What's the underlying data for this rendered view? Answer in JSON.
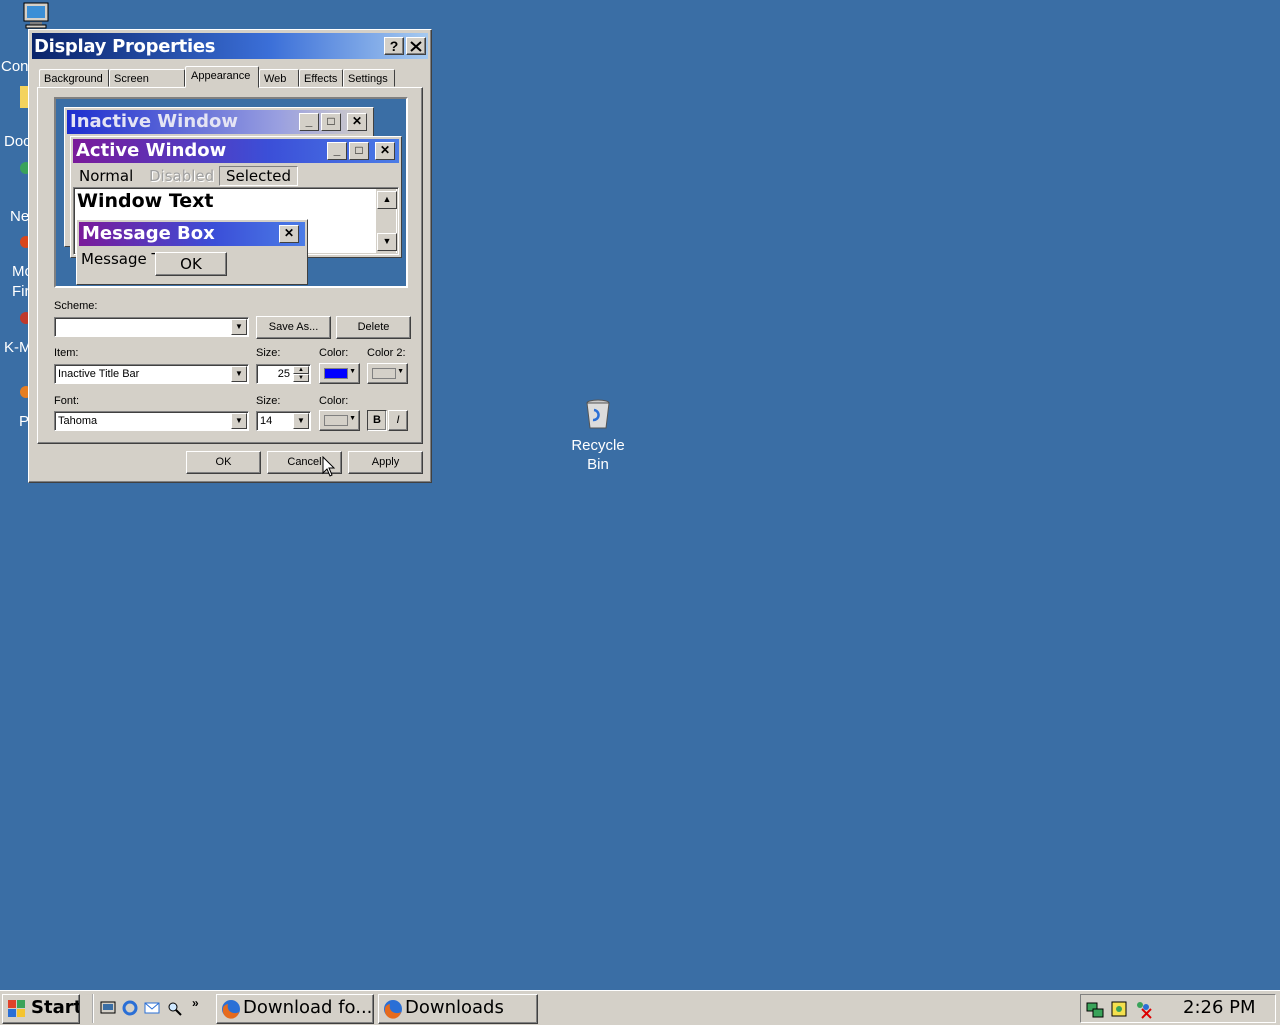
{
  "desktop": {
    "recycle_bin_label_1": "Recycle",
    "recycle_bin_label_2": "Bin",
    "left_icon_labels": [
      "Con",
      "Doc",
      "Ne",
      "Mo",
      "Fir",
      "K-M",
      "P"
    ]
  },
  "dialog": {
    "title": "Display Properties",
    "help_label": "?",
    "close_label": "✕",
    "tabs": [
      "Background",
      "Screen Saver",
      "Appearance",
      "Web",
      "Effects",
      "Settings"
    ],
    "active_tab": "Appearance",
    "preview": {
      "inactive_title": "Inactive Window",
      "active_title": "Active Window",
      "menu_normal": "Normal",
      "menu_disabled": "Disabled",
      "menu_selected": "Selected",
      "window_text": "Window Text",
      "msgbox_title": "Message Box",
      "msgbox_text": "Message T",
      "msgbox_ok": "OK"
    },
    "scheme_label": "Scheme:",
    "scheme_value": "",
    "save_as_label": "Save As...",
    "delete_label": "Delete",
    "item_label": "Item:",
    "item_value": "Inactive Title Bar",
    "size_label": "Size:",
    "item_size_value": "25",
    "color_label": "Color:",
    "color2_label": "Color 2:",
    "font_label": "Font:",
    "font_value": "Tahoma",
    "font_size_value": "14",
    "bold_label": "B",
    "italic_label": "I",
    "ok_label": "OK",
    "cancel_label": "Cancel",
    "apply_label": "Apply",
    "colors": {
      "item_color": "#0000ff",
      "item_color2": "#d4d0c8",
      "font_color": "#d4d0c8"
    }
  },
  "taskbar": {
    "start_label": "Start",
    "tasks": [
      "Download fo...",
      "Downloads"
    ],
    "clock": "2:26 PM"
  }
}
